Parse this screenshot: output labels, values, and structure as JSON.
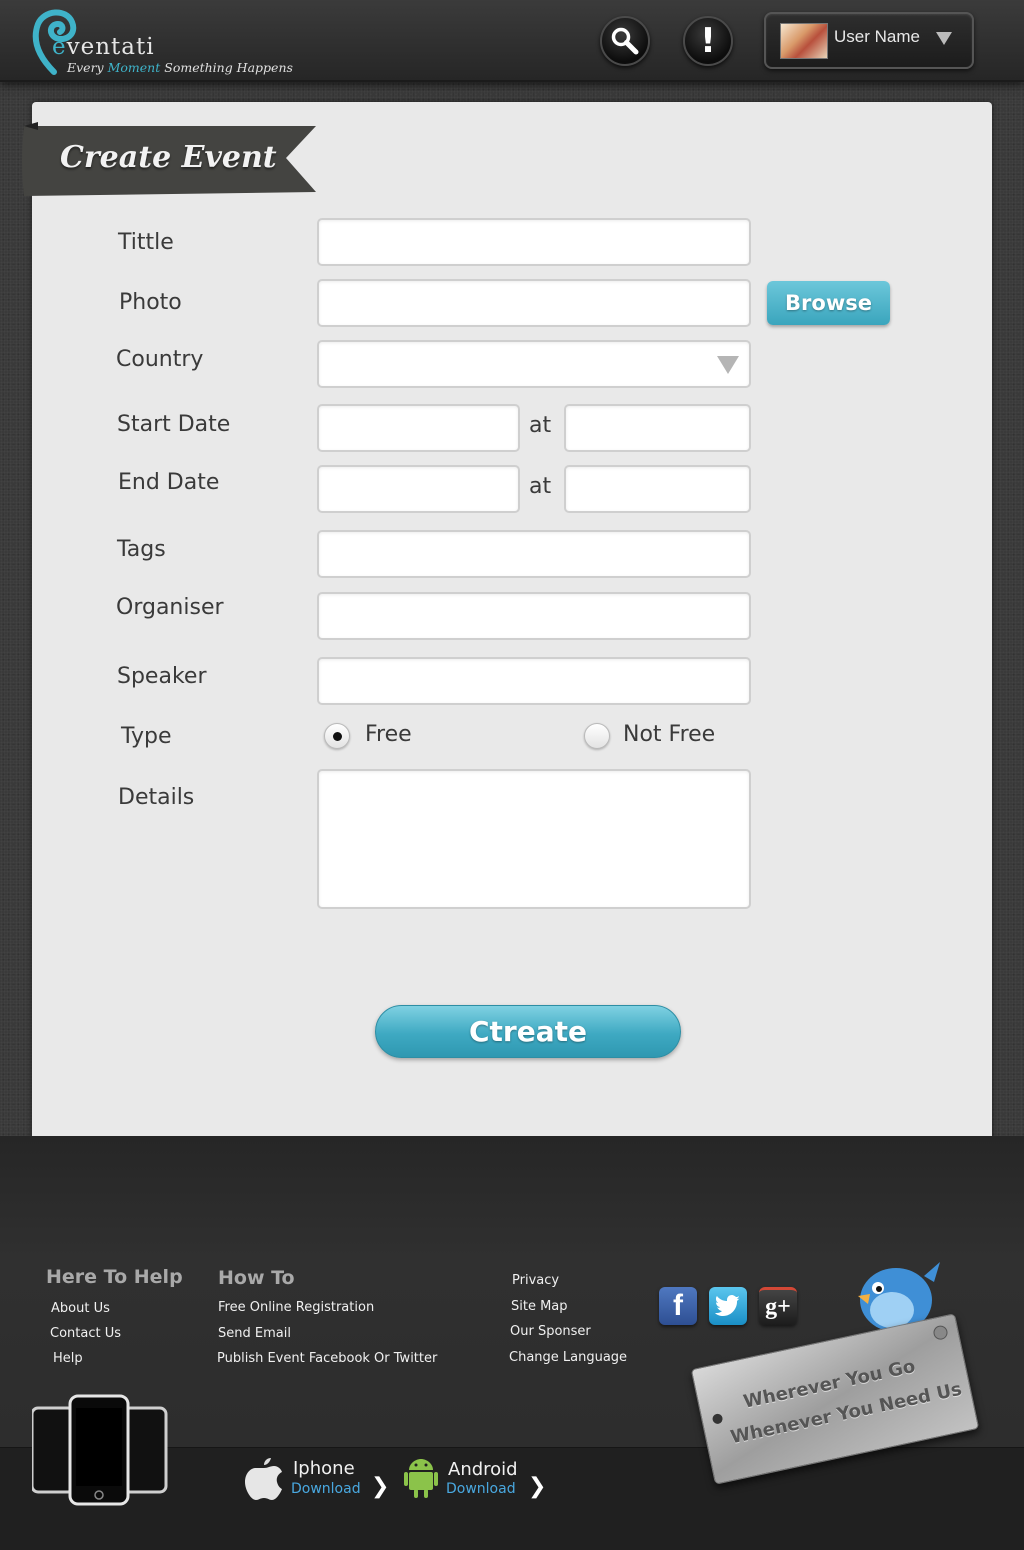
{
  "header": {
    "logo_name_prefix": "e",
    "logo_name": "ventati",
    "tagline_start": "Every",
    "tagline_accent": "Moment",
    "tagline_end": "Something Happens",
    "alert_glyph": "!",
    "user_name": "User Name"
  },
  "page": {
    "title": "Create Event"
  },
  "form": {
    "title_label": "Tittle",
    "photo_label": "Photo",
    "browse_label": "Browse",
    "country_label": "Country",
    "start_date_label": "Start Date",
    "end_date_label": "End Date",
    "at_label": "at",
    "tags_label": "Tags",
    "organiser_label": "Organiser",
    "speaker_label": "Speaker",
    "type_label": "Type",
    "type_options": [
      "Free",
      "Not Free"
    ],
    "type_selected": "Free",
    "details_label": "Details",
    "submit_label": "Ctreate"
  },
  "footer": {
    "help_heading": "Here To Help",
    "help_links": [
      "About Us",
      "Contact Us",
      "Help"
    ],
    "howto_heading": "How To",
    "howto_links": [
      "Free Online Registration",
      "Send Email",
      "Publish Event Facebook Or Twitter"
    ],
    "misc_links": [
      "Privacy",
      "Site Map",
      "Our Sponser",
      "Change Language"
    ],
    "social": {
      "facebook_glyph": "f",
      "googleplus_glyph": "g+"
    },
    "plate_line1": "Wherever You Go",
    "plate_line2": "Whenever You Need Us",
    "iphone_name": "Iphone",
    "iphone_sub": "Download",
    "android_name": "Android",
    "android_sub": "Download",
    "arrow": "❯"
  },
  "colors": {
    "accent": "#3fb3c9",
    "button": "#3aa5bd",
    "background": "#3a3a3a",
    "card": "#e9e9e9"
  },
  "icons": [
    "search-icon",
    "alert-icon",
    "chevron-down-icon",
    "facebook-icon",
    "twitter-icon",
    "google-plus-icon",
    "apple-icon",
    "android-icon",
    "twitter-bird-mascot"
  ]
}
